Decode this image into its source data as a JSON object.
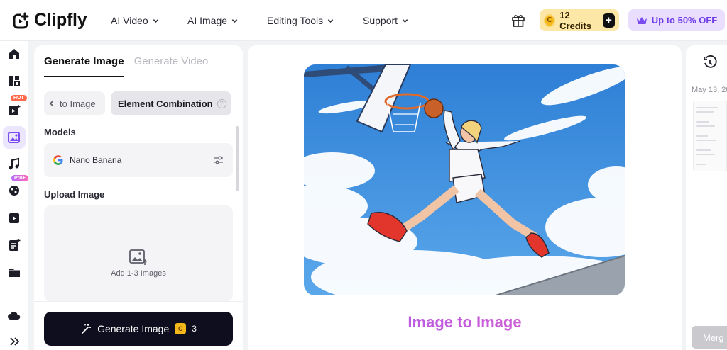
{
  "brand": {
    "name": "Clipfly"
  },
  "nav": [
    {
      "label": "AI Video"
    },
    {
      "label": "AI Image"
    },
    {
      "label": "Editing Tools"
    },
    {
      "label": "Support"
    }
  ],
  "credits": {
    "coin": "C",
    "label": "12 Credits",
    "plus": "+"
  },
  "promo": {
    "label": "Up to 50% OFF"
  },
  "rail": {
    "badge_hot": "HOT",
    "badge_pro": "Pro+",
    "icons": [
      "home-icon",
      "templates-icon",
      "video-icon",
      "image-icon",
      "music-icon",
      "effects-icon",
      "player-icon",
      "script-icon",
      "folder-icon",
      "cloud-icon",
      "expand-icon"
    ]
  },
  "panel": {
    "tabs": [
      "Generate Image",
      "Generate Video"
    ],
    "subtabs": {
      "left": "to Image",
      "right": "Element Combination",
      "help": "?"
    },
    "models_label": "Models",
    "model_name": "Nano Banana",
    "upload_label": "Upload Image",
    "upload_hint": "Add 1-3 Images",
    "generate": {
      "label": "Generate Image",
      "coin": "C",
      "cost": "3"
    }
  },
  "center": {
    "title": "Image to Image"
  },
  "history": {
    "date": "May 13, 20",
    "merge": "Merg"
  },
  "colors": {
    "accent_purple": "#6f3de8",
    "credits_bg": "#fce7a6",
    "promo_bg": "#e9defd",
    "generate_bg": "#0e0e1f"
  }
}
